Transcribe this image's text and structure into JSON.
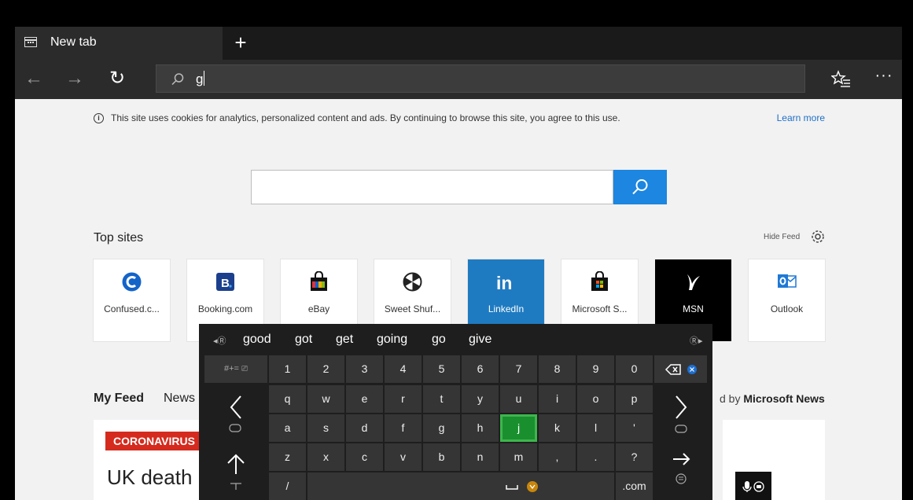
{
  "tab": {
    "title": "New tab",
    "new_tab_symbol": "+"
  },
  "nav": {
    "back_symbol": "←",
    "forward_symbol": "→",
    "refresh_symbol": "↻",
    "address_value": "g",
    "more_symbol": "···"
  },
  "cookie": {
    "info_symbol": "i",
    "text": "This site uses cookies for analytics, personalized content and ads. By continuing to browse this site, you agree to this use.",
    "learn_more": "Learn more"
  },
  "top_sites": {
    "title": "Top sites",
    "hide_feed": "Hide Feed",
    "tiles": [
      {
        "label": "Confused.c...",
        "icon": "confused-icon",
        "color": "#1464c8"
      },
      {
        "label": "Booking.com",
        "icon": "booking-icon",
        "color": "#1b3f8c"
      },
      {
        "label": "eBay",
        "icon": "ebay-bag-icon",
        "color": "#e53238"
      },
      {
        "label": "Sweet Shuf...",
        "icon": "sweet-shuffle-icon",
        "color": "#222222"
      },
      {
        "label": "LinkedIn",
        "icon": "linkedin-icon",
        "color": "#1f7bc1"
      },
      {
        "label": "Microsoft S...",
        "icon": "microsoft-store-icon",
        "color": "#222222"
      },
      {
        "label": "MSN",
        "icon": "msn-icon",
        "color": "#000000"
      },
      {
        "label": "Outlook",
        "icon": "outlook-icon",
        "color": "#1e78d6"
      }
    ]
  },
  "feed": {
    "tab_active": "My Feed",
    "tab_other": "News",
    "powered_prefix": "d by ",
    "powered_brand": "Microsoft News",
    "badge": "CORONAVIRUS",
    "headline": "UK death "
  },
  "keyboard": {
    "suggestions": [
      "good",
      "got",
      "get",
      "going",
      "go",
      "give"
    ],
    "row_numbers": [
      "1",
      "2",
      "3",
      "4",
      "5",
      "6",
      "7",
      "8",
      "9",
      "0"
    ],
    "row_q": [
      "q",
      "w",
      "e",
      "r",
      "t",
      "y",
      "u",
      "i",
      "o",
      "p"
    ],
    "row_a": [
      "a",
      "s",
      "d",
      "f",
      "g",
      "h",
      "j",
      "k",
      "l",
      "'"
    ],
    "row_z": [
      "z",
      "x",
      "c",
      "v",
      "b",
      "n",
      "m",
      ",",
      ".",
      "?"
    ],
    "symbols_key": "#+=",
    "slash_key": "/",
    "dotcom_key": ".com",
    "highlighted_key": "j"
  }
}
